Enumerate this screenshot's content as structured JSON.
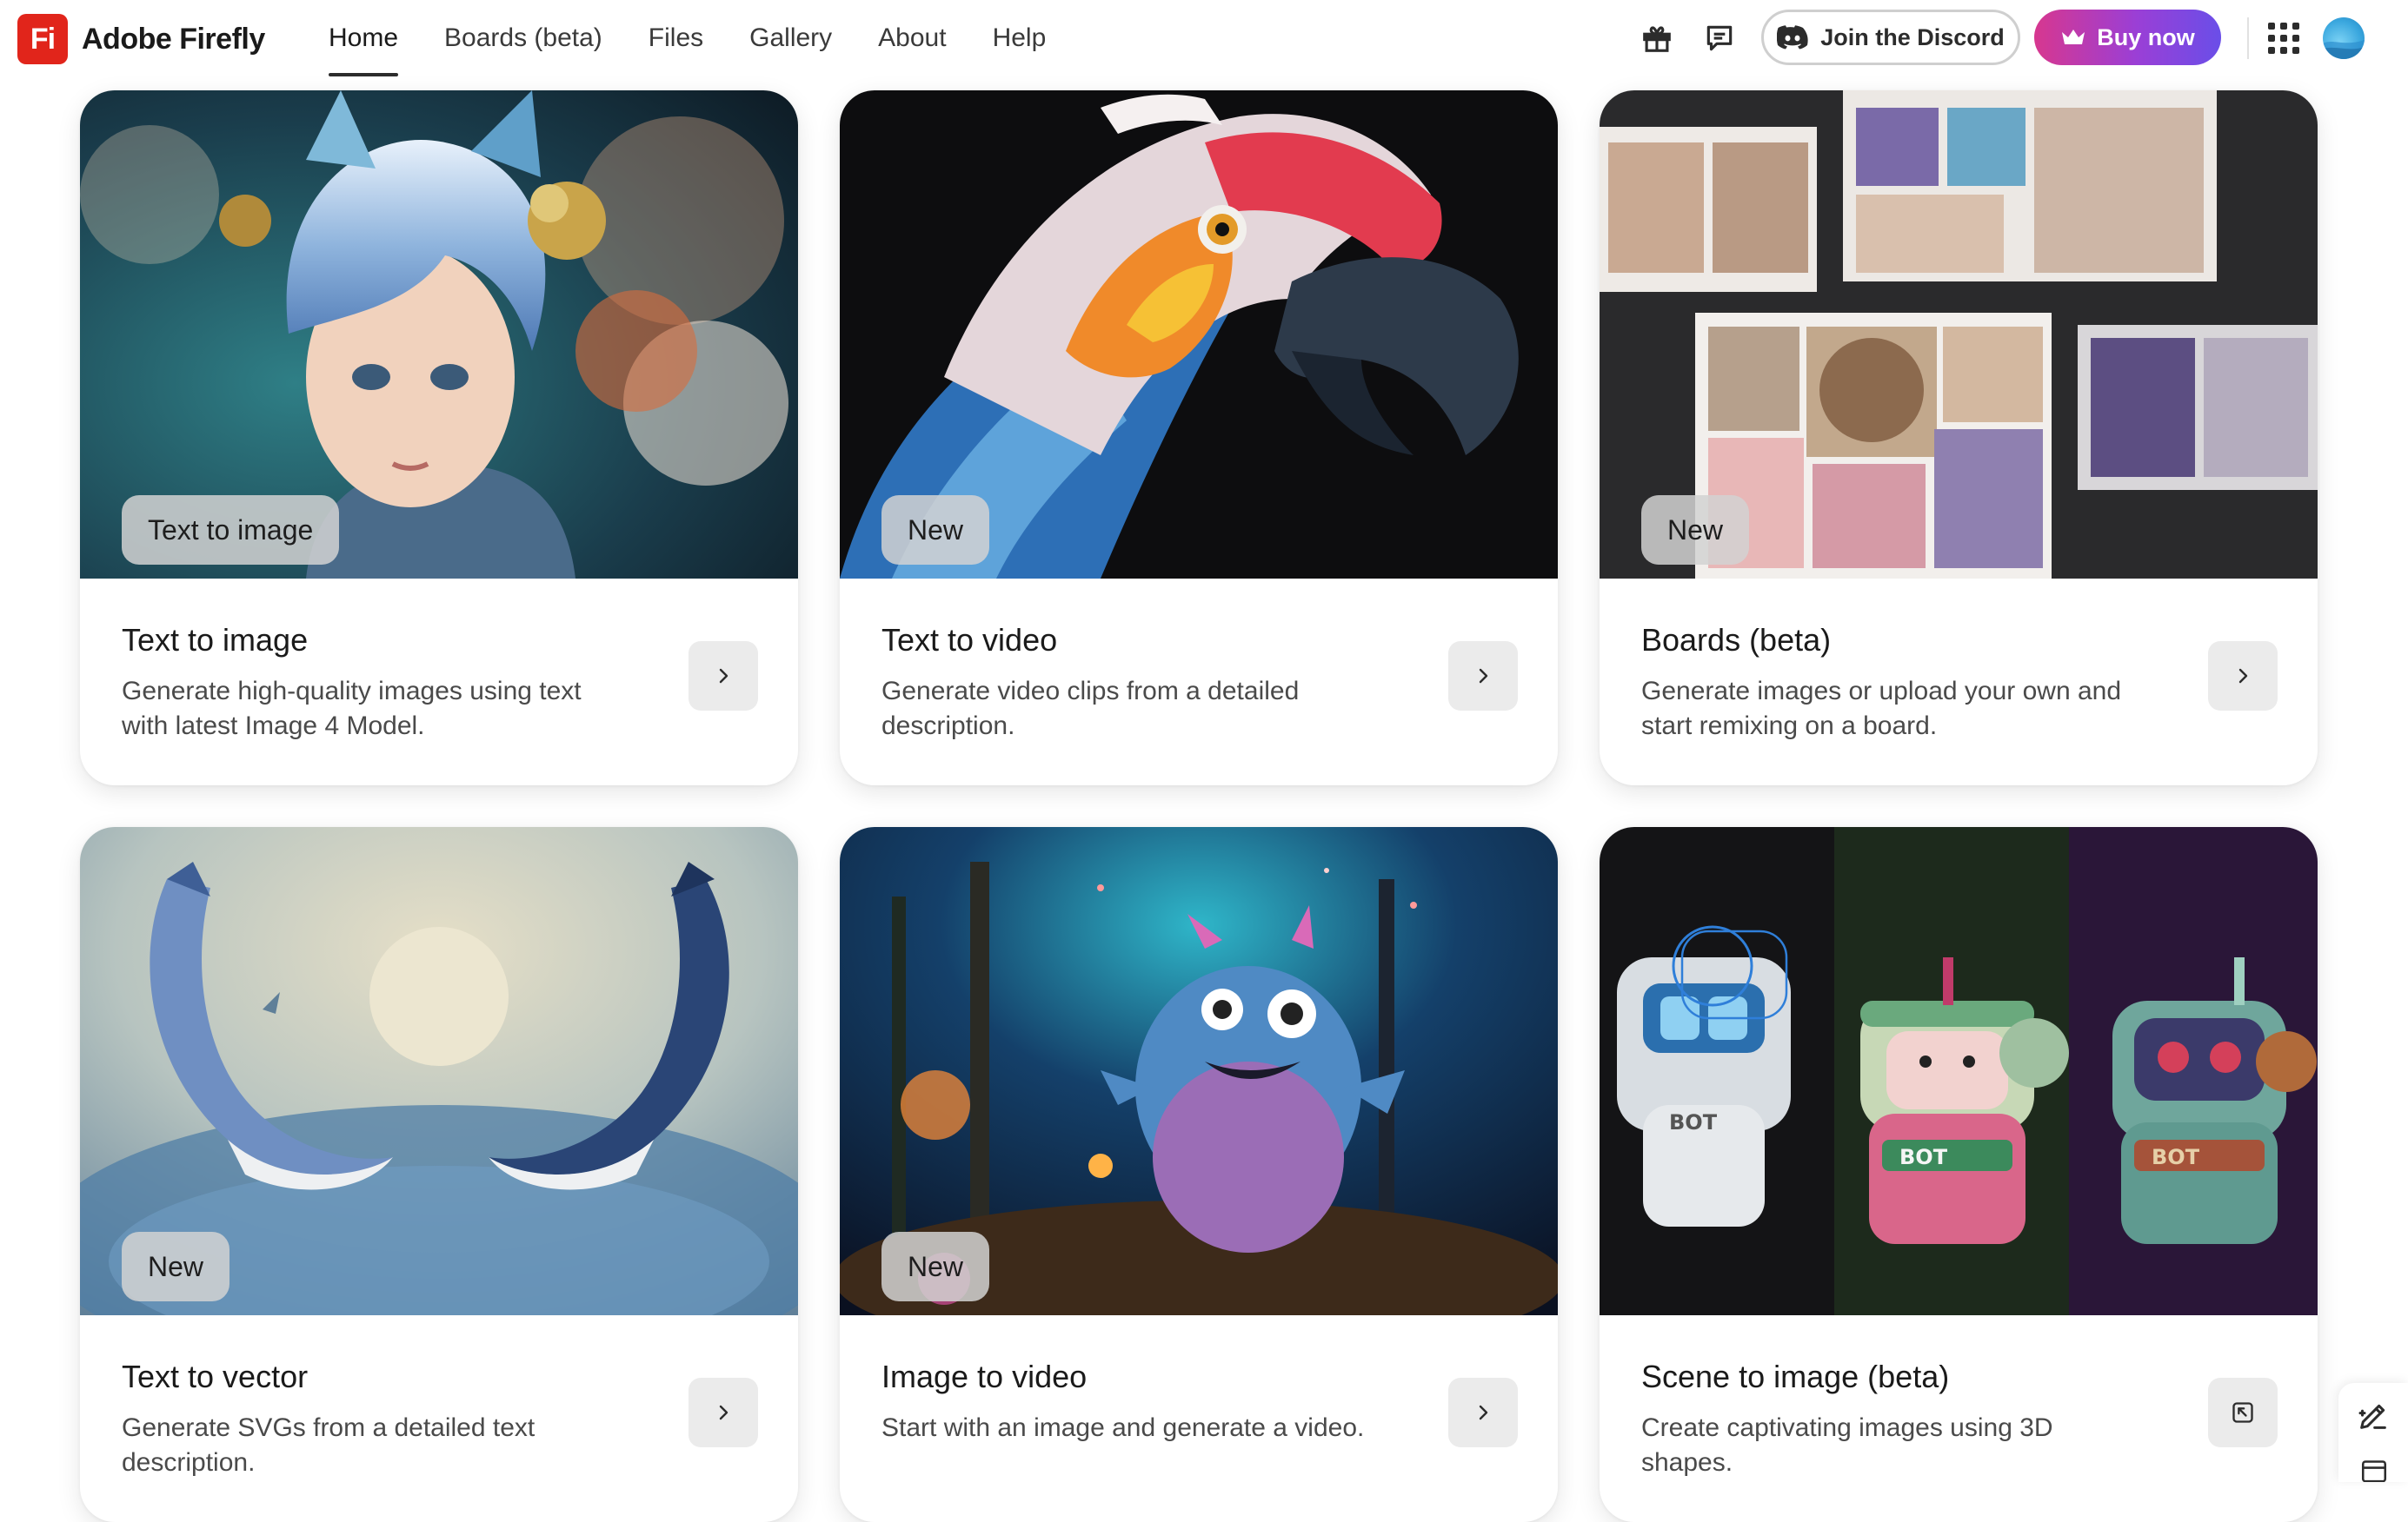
{
  "app": {
    "logo_mark": "Fi",
    "brand": "Adobe Firefly"
  },
  "nav": {
    "items": [
      {
        "label": "Home",
        "active": true
      },
      {
        "label": "Boards (beta)",
        "active": false
      },
      {
        "label": "Files",
        "active": false
      },
      {
        "label": "Gallery",
        "active": false
      },
      {
        "label": "About",
        "active": false
      },
      {
        "label": "Help",
        "active": false
      }
    ]
  },
  "header_actions": {
    "gift_icon": "gift-icon",
    "feedback_icon": "chat-bubble-icon",
    "discord_label": "Join the Discord",
    "buy_label": "Buy now",
    "apps_icon": "app-grid-icon",
    "brand_gradient": [
      "#d7378f",
      "#9a3fd6",
      "#6a4ee8"
    ]
  },
  "cards": [
    {
      "badge": "Text to image",
      "title": "Text to image",
      "desc": "Generate high-quality images using text with latest Image 4 Model.",
      "action_icon": "chevron-right-icon",
      "image": "blue-haired-child-portrait"
    },
    {
      "badge": "New",
      "title": "Text to video",
      "desc": "Generate video clips from a detailed description.",
      "action_icon": "chevron-right-icon",
      "image": "parrot-closeup"
    },
    {
      "badge": "New",
      "title": "Boards (beta)",
      "desc": "Generate images or upload your own and start remixing on a board.",
      "action_icon": "chevron-right-icon",
      "image": "moodboard-collage"
    },
    {
      "badge": "New",
      "title": "Text to vector",
      "desc": "Generate SVGs from a detailed text description.",
      "action_icon": "chevron-right-icon",
      "image": "two-whales-moon"
    },
    {
      "badge": "New",
      "title": "Image to video",
      "desc": "Start with an image and generate a video.",
      "action_icon": "chevron-right-icon",
      "image": "fuzzy-monster-forest"
    },
    {
      "badge": "",
      "title": "Scene to image (beta)",
      "desc": "Create captivating images using 3D shapes.",
      "action_icon": "open-external-icon",
      "image": "three-bot-robots"
    }
  ],
  "floating_tool": {
    "icon": "edit-sparkle-icon"
  }
}
